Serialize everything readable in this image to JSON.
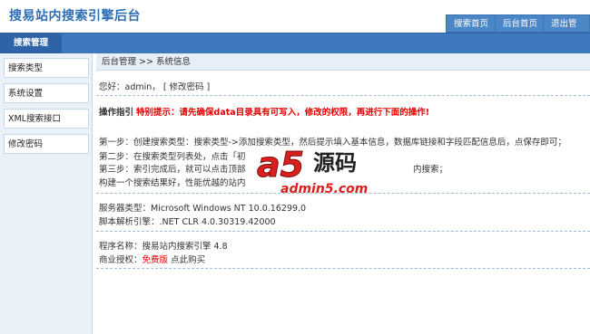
{
  "header": {
    "brand": "搜易站内搜索引擎后台",
    "buttons": [
      "搜索首页",
      "后台首页",
      "退出管理"
    ]
  },
  "nav": {
    "tab": "搜索管理"
  },
  "sidebar": {
    "items": [
      "搜索类型",
      "系统设置",
      "XML搜索接口",
      "修改密码"
    ]
  },
  "breadcrumb": "后台管理 >> 系统信息",
  "greeting": {
    "text": "您好：admin，",
    "link": "[ 修改密码 ]"
  },
  "guide": {
    "title": "操作指引",
    "warning": "特别提示：请先确保data目录具有可写入，修改的权限，再进行下面的操作!",
    "steps": [
      "第一步：创建搜索类型：搜索类型->添加搜索类型，然后提示填入基本信息，数据库链接和字段匹配信息后，点保存即可；",
      "第二步：在搜索类型列表处，点击「初",
      "第三步：索引完成后，就可以点击顶部",
      "构建一个搜索结果好，性能优越的站内"
    ],
    "step3_tail": "内搜索；"
  },
  "server": {
    "type": "服务器类型：Microsoft Windows NT 10.0.16299.0",
    "engine": "脚本解析引擎：.NET CLR 4.0.30319.42000"
  },
  "program": {
    "name": "程序名称：搜易站内搜索引擎 4.8",
    "license_label": "商业授权：",
    "license_value": "免费版",
    "license_link": "点此购买"
  },
  "watermark": {
    "glyph": "a5",
    "cn": "源码",
    "url": "admin5.com"
  }
}
